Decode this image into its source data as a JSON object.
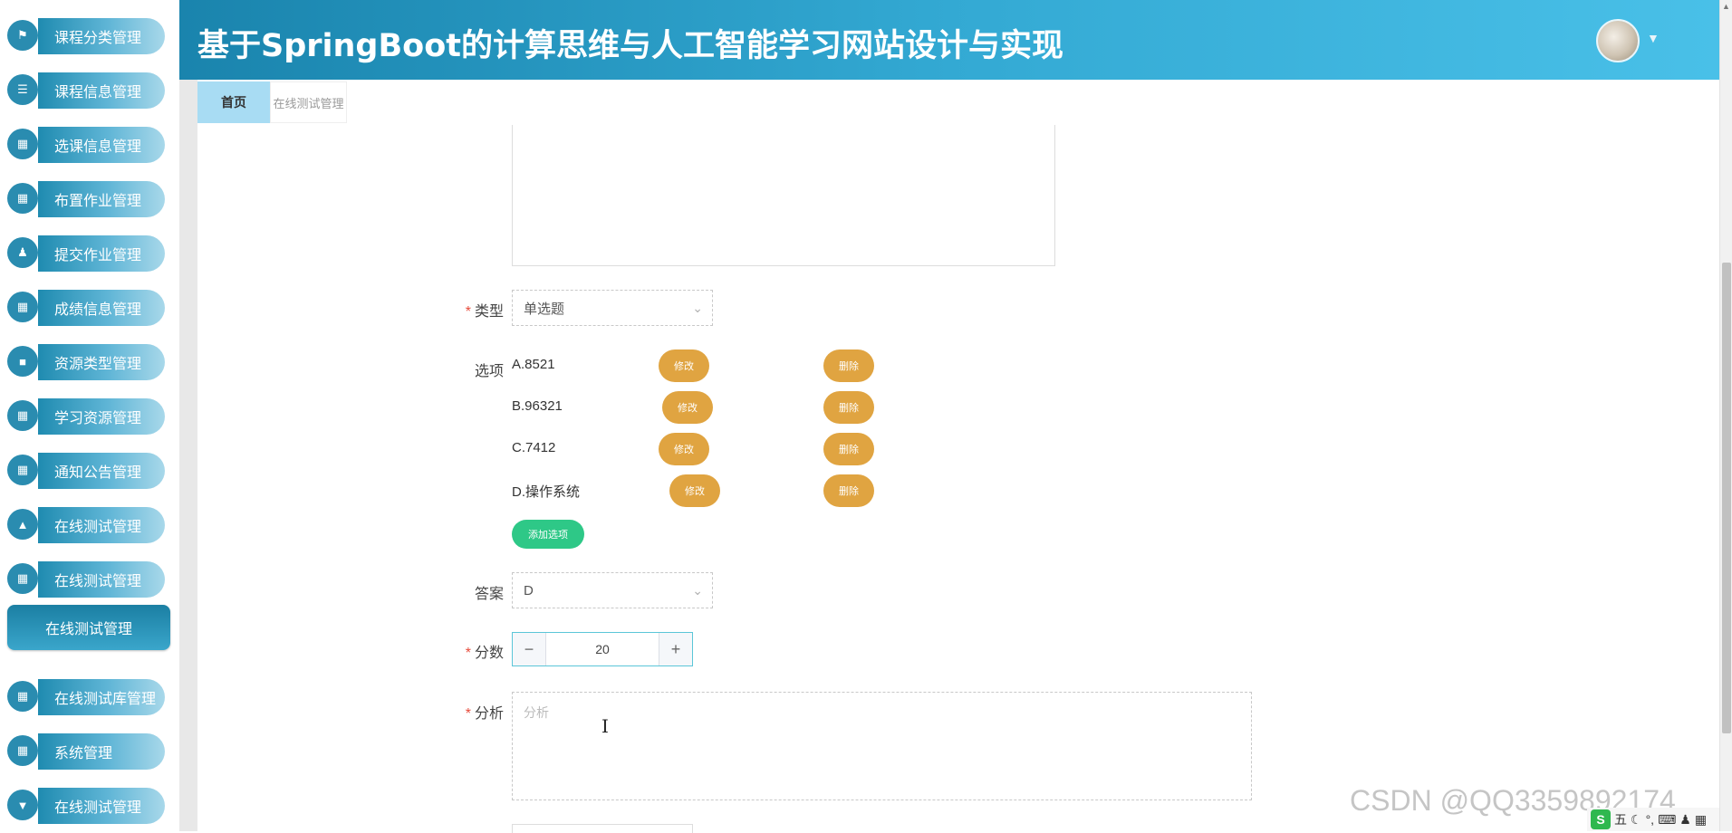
{
  "header": {
    "title": "基于SpringBoot的计算思维与人工智能学习网站设计与实现"
  },
  "tabs": {
    "home": "首页",
    "current": "在线测试管理"
  },
  "sidebar": {
    "items": [
      {
        "label": "课程分类管理",
        "icon": "flag-icon"
      },
      {
        "label": "课程信息管理",
        "icon": "list-icon"
      },
      {
        "label": "选课信息管理",
        "icon": "grid-icon"
      },
      {
        "label": "布置作业管理",
        "icon": "grid-icon"
      },
      {
        "label": "提交作业管理",
        "icon": "user-icon"
      },
      {
        "label": "成绩信息管理",
        "icon": "grid-icon"
      },
      {
        "label": "资源类型管理",
        "icon": "briefcase-icon"
      },
      {
        "label": "学习资源管理",
        "icon": "grid-icon"
      },
      {
        "label": "通知公告管理",
        "icon": "table-icon"
      },
      {
        "label": "在线测试管理",
        "icon": "chart-icon"
      },
      {
        "label": "在线测试管理",
        "icon": "grid-icon"
      },
      {
        "label": "在线测试库管理",
        "icon": "grid-icon"
      },
      {
        "label": "系统管理",
        "icon": "grid-icon"
      },
      {
        "label": "在线测试管理",
        "icon": "pin-icon"
      }
    ],
    "active": "在线测试管理"
  },
  "form": {
    "type_label": "类型",
    "type_value": "单选题",
    "options_label": "选项",
    "options": [
      {
        "text": "A.8521",
        "edit": "修改",
        "delete": "删除"
      },
      {
        "text": "B.96321",
        "edit": "修改",
        "delete": "删除"
      },
      {
        "text": "C.7412",
        "edit": "修改",
        "delete": "删除"
      },
      {
        "text": "D.操作系统",
        "edit": "修改",
        "delete": "删除"
      }
    ],
    "add_option": "添加选项",
    "answer_label": "答案",
    "answer_value": "D",
    "score_label": "分数",
    "score_value": "20",
    "analysis_label": "分析",
    "analysis_placeholder": "分析"
  },
  "watermark": "CSDN @QQ3359892174",
  "tray": {
    "ime": "五"
  }
}
